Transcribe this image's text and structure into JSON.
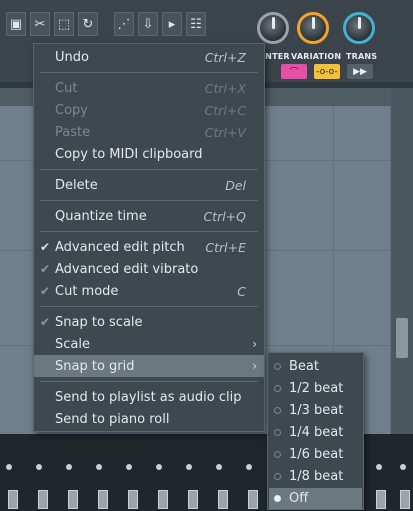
{
  "toolbar": {
    "tool_icons": [
      "save-icon",
      "scissors-icon",
      "select-icon",
      "refresh-icon",
      "steps-icon",
      "save-download-icon",
      "folder-icon",
      "piano-icon"
    ],
    "knobs": [
      {
        "label": "INTER",
        "ring_color": "#9aa3a9"
      },
      {
        "label": "VARIATION",
        "ring_color": "#f2a32a"
      },
      {
        "label": "TRANS",
        "ring_color": "#3fb2d6"
      }
    ],
    "mode_buttons": [
      {
        "glyph": "⌒",
        "color": "#e74fa6"
      },
      {
        "glyph": "-o-o-",
        "color": "#f4c23a"
      },
      {
        "glyph": "▶▶",
        "color": "#55616a"
      }
    ]
  },
  "context_menu": {
    "items": [
      {
        "label": "Undo",
        "shortcut": "Ctrl+Z",
        "enabled": true
      },
      {
        "label": "Cut",
        "shortcut": "Ctrl+X",
        "enabled": false
      },
      {
        "label": "Copy",
        "shortcut": "Ctrl+C",
        "enabled": false
      },
      {
        "label": "Paste",
        "shortcut": "Ctrl+V",
        "enabled": false
      },
      {
        "label": "Copy to MIDI clipboard",
        "shortcut": "",
        "enabled": true
      },
      {
        "label": "Delete",
        "shortcut": "Del",
        "enabled": true
      },
      {
        "label": "Quantize time",
        "shortcut": "Ctrl+Q",
        "enabled": true
      },
      {
        "label": "Advanced edit pitch",
        "shortcut": "Ctrl+E",
        "enabled": true,
        "checked": true
      },
      {
        "label": "Advanced edit vibrato",
        "shortcut": "",
        "enabled": true,
        "checked": true
      },
      {
        "label": "Cut mode",
        "shortcut": "C",
        "enabled": true,
        "checked": true
      },
      {
        "label": "Snap to scale",
        "shortcut": "",
        "enabled": true,
        "checked": true
      },
      {
        "label": "Scale",
        "shortcut": "",
        "enabled": true,
        "submenu": true
      },
      {
        "label": "Snap to grid",
        "shortcut": "",
        "enabled": true,
        "submenu": true,
        "highlighted": true
      },
      {
        "label": "Send to playlist as audio clip",
        "shortcut": "",
        "enabled": true
      },
      {
        "label": "Send to piano roll",
        "shortcut": "",
        "enabled": true
      }
    ]
  },
  "snap_submenu": {
    "options": [
      "Beat",
      "1/2 beat",
      "1/3 beat",
      "1/4 beat",
      "1/6 beat",
      "1/8 beat",
      "Off"
    ],
    "selected": "Off"
  }
}
